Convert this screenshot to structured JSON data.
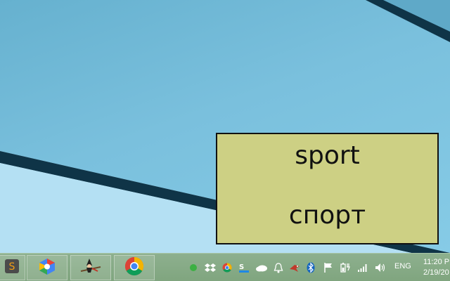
{
  "popup": {
    "word_en": "sport",
    "word_ru": "спорт",
    "background": "#cdd084"
  },
  "taskbar": {
    "apps": [
      {
        "name": "sublime-text-icon"
      },
      {
        "name": "google-cloud-icon"
      },
      {
        "name": "witch-app-icon"
      },
      {
        "name": "chrome-icon"
      }
    ],
    "tray_icons": [
      "green-dot-icon",
      "dropbox-icon",
      "chrome-tray-icon",
      "skype-icon",
      "onedrive-icon",
      "notification-bell-icon",
      "bird-icon",
      "bluetooth-icon",
      "flag-icon",
      "battery-icon",
      "signal-icon",
      "volume-icon"
    ],
    "language": "ENG",
    "time": "11:20 P",
    "date": "2/19/20"
  }
}
